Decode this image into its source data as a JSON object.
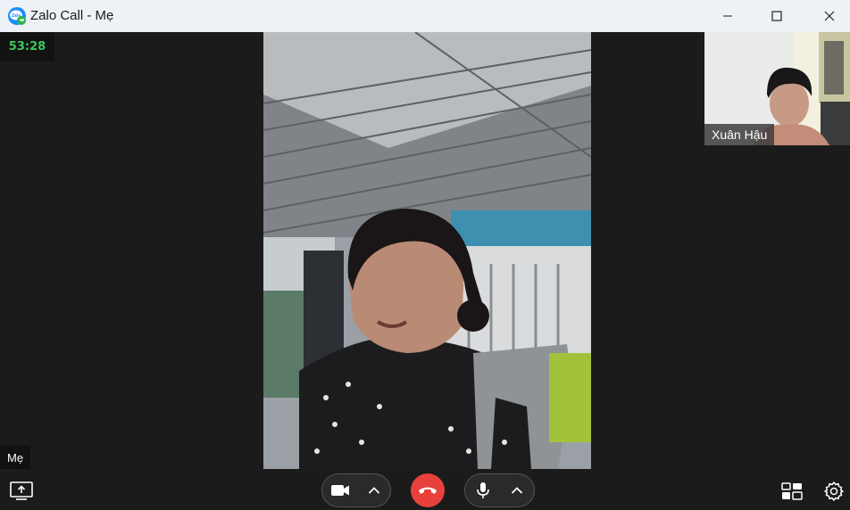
{
  "window": {
    "title": "Zalo Call - Mẹ",
    "logo_icon": "zalo-logo",
    "controls": [
      "minimize-icon",
      "maximize-icon",
      "close-icon"
    ]
  },
  "call": {
    "duration": "53:28",
    "remote_participant": "Mẹ",
    "self_participant": "Xuân Hậu"
  },
  "toolbar": {
    "left_icon": "screen-share-icon",
    "camera_icon": "video-camera-icon",
    "camera_options_icon": "chevron-up-icon",
    "end_call_icon": "hang-up-icon",
    "mic_icon": "microphone-icon",
    "mic_options_icon": "chevron-up-icon",
    "layout_icon": "layout-grid-icon",
    "settings_icon": "gear-icon"
  },
  "colors": {
    "timer": "#3cc65e",
    "end_call": "#e8413c",
    "background": "#1b1b1b",
    "titlebar": "#eef1f6"
  }
}
